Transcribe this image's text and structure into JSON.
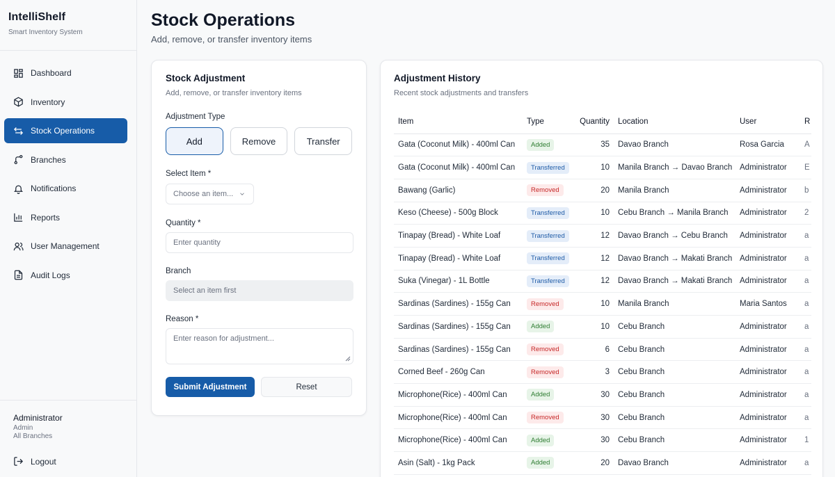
{
  "app": {
    "title": "IntelliShelf",
    "subtitle": "Smart Inventory System"
  },
  "sidebar": {
    "items": [
      {
        "label": "Dashboard",
        "icon": "dashboard-icon"
      },
      {
        "label": "Inventory",
        "icon": "box-icon"
      },
      {
        "label": "Stock Operations",
        "icon": "swap-arrows-icon",
        "active": true
      },
      {
        "label": "Branches",
        "icon": "git-branch-icon"
      },
      {
        "label": "Notifications",
        "icon": "bell-icon"
      },
      {
        "label": "Reports",
        "icon": "bar-chart-icon"
      },
      {
        "label": "User Management",
        "icon": "users-icon"
      },
      {
        "label": "Audit Logs",
        "icon": "file-text-icon"
      }
    ],
    "user": {
      "name": "Administrator",
      "role": "Admin",
      "branch": "All Branches"
    },
    "logout_label": "Logout"
  },
  "page": {
    "title": "Stock Operations",
    "subtitle": "Add, remove, or transfer inventory items"
  },
  "form": {
    "title": "Stock Adjustment",
    "subtitle": "Add, remove, or transfer inventory items",
    "type_label": "Adjustment Type",
    "types": [
      "Add",
      "Remove",
      "Transfer"
    ],
    "selected_type": "Add",
    "item_label": "Select Item *",
    "item_placeholder": "Choose an item...",
    "quantity_label": "Quantity *",
    "quantity_placeholder": "Enter quantity",
    "branch_label": "Branch",
    "branch_placeholder": "Select an item first",
    "reason_label": "Reason *",
    "reason_placeholder": "Enter reason for adjustment...",
    "submit_label": "Submit Adjustment",
    "reset_label": "Reset"
  },
  "history": {
    "title": "Adjustment History",
    "subtitle": "Recent stock adjustments and transfers",
    "columns": [
      "Item",
      "Type",
      "Quantity",
      "Location",
      "User",
      "R"
    ],
    "rows": [
      {
        "item": "Gata (Coconut Milk) - 400ml Can",
        "type": "Added",
        "qty": "35",
        "location": "Davao Branch",
        "user": "Rosa Garcia",
        "extra": "A"
      },
      {
        "item": "Gata (Coconut Milk) - 400ml Can",
        "type": "Transferred",
        "qty": "10",
        "location": "Manila Branch → Davao Branch",
        "user": "Administrator",
        "extra": "E"
      },
      {
        "item": "Bawang (Garlic)",
        "type": "Removed",
        "qty": "20",
        "location": "Manila Branch",
        "user": "Administrator",
        "extra": "b"
      },
      {
        "item": "Keso (Cheese) - 500g Block",
        "type": "Transferred",
        "qty": "10",
        "location": "Cebu Branch → Manila Branch",
        "user": "Administrator",
        "extra": "2"
      },
      {
        "item": "Tinapay (Bread) - White Loaf",
        "type": "Transferred",
        "qty": "12",
        "location": "Davao Branch → Cebu Branch",
        "user": "Administrator",
        "extra": "a"
      },
      {
        "item": "Tinapay (Bread) - White Loaf",
        "type": "Transferred",
        "qty": "12",
        "location": "Davao Branch → Makati Branch",
        "user": "Administrator",
        "extra": "a"
      },
      {
        "item": "Suka (Vinegar) - 1L Bottle",
        "type": "Transferred",
        "qty": "12",
        "location": "Davao Branch → Makati Branch",
        "user": "Administrator",
        "extra": "a"
      },
      {
        "item": "Sardinas (Sardines) - 155g Can",
        "type": "Removed",
        "qty": "10",
        "location": "Manila Branch",
        "user": "Maria Santos",
        "extra": "a"
      },
      {
        "item": "Sardinas (Sardines) - 155g Can",
        "type": "Added",
        "qty": "10",
        "location": "Cebu Branch",
        "user": "Administrator",
        "extra": "a"
      },
      {
        "item": "Sardinas (Sardines) - 155g Can",
        "type": "Removed",
        "qty": "6",
        "location": "Cebu Branch",
        "user": "Administrator",
        "extra": "a"
      },
      {
        "item": "Corned Beef - 260g Can",
        "type": "Removed",
        "qty": "3",
        "location": "Cebu Branch",
        "user": "Administrator",
        "extra": "a"
      },
      {
        "item": "Microphone(Rice) - 400ml Can",
        "type": "Added",
        "qty": "30",
        "location": "Cebu Branch",
        "user": "Administrator",
        "extra": "a"
      },
      {
        "item": "Microphone(Rice) - 400ml Can",
        "type": "Removed",
        "qty": "30",
        "location": "Cebu Branch",
        "user": "Administrator",
        "extra": "a"
      },
      {
        "item": "Microphone(Rice) - 400ml Can",
        "type": "Added",
        "qty": "30",
        "location": "Cebu Branch",
        "user": "Administrator",
        "extra": "1"
      },
      {
        "item": "Asin (Salt) - 1kg Pack",
        "type": "Added",
        "qty": "20",
        "location": "Davao Branch",
        "user": "Administrator",
        "extra": "a"
      }
    ]
  },
  "colors": {
    "accent": "#175ca8",
    "added": "#2f7d32",
    "removed": "#c62828",
    "transferred": "#1d5aa6"
  }
}
